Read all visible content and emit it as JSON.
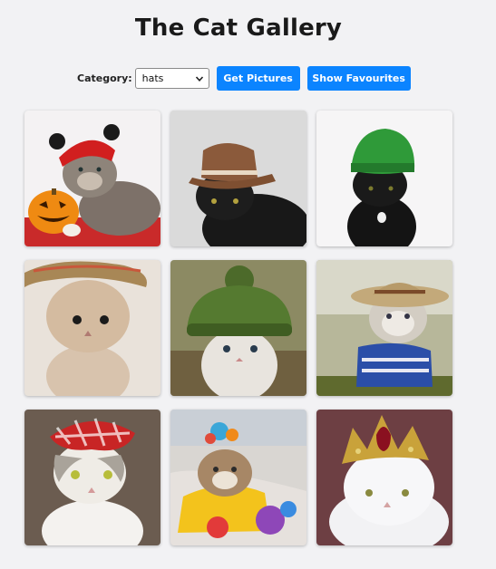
{
  "header": {
    "title": "The Cat Gallery"
  },
  "controls": {
    "category_label": "Category:",
    "category_value": "hats",
    "get_button": "Get Pictures",
    "fav_button": "Show Favourites"
  },
  "icons": {
    "select_arrow": "chevron-down-icon"
  },
  "colors": {
    "button": "#0b84ff",
    "background": "#f2f2f4"
  },
  "gallery": {
    "images": [
      {
        "name": "cat-red-devil-hat-pumpkin"
      },
      {
        "name": "black-cat-brown-fedora"
      },
      {
        "name": "black-cat-green-beanie"
      },
      {
        "name": "kitten-straw-hat"
      },
      {
        "name": "kitten-green-knit-hat"
      },
      {
        "name": "tabby-straw-boater-sweater"
      },
      {
        "name": "cat-red-gingham-bonnet"
      },
      {
        "name": "cat-yellow-outfit-toys"
      },
      {
        "name": "white-persian-crown"
      }
    ]
  }
}
